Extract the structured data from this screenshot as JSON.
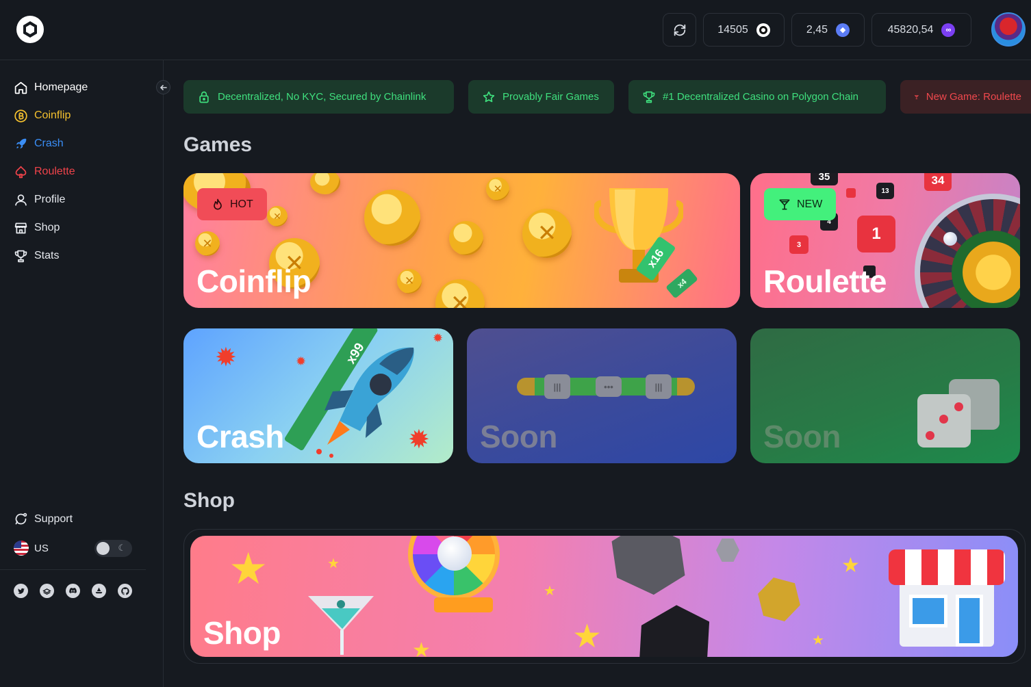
{
  "header": {
    "balances": [
      {
        "value": "14505",
        "icon": "token-icon",
        "color": "#ffffff"
      },
      {
        "value": "2,45",
        "icon": "eth-icon",
        "color": "#5b7cf5"
      },
      {
        "value": "45820,54",
        "icon": "polygon-icon",
        "color": "#7b3ff2"
      }
    ]
  },
  "sidebar": {
    "items": [
      {
        "label": "Homepage",
        "color": "#ffffff"
      },
      {
        "label": "Coinflip",
        "color": "#f5c12e"
      },
      {
        "label": "Crash",
        "color": "#3a8ef6"
      },
      {
        "label": "Roulette",
        "color": "#f0434a"
      },
      {
        "label": "Profile",
        "color": "#e6e9ee"
      },
      {
        "label": "Shop",
        "color": "#e6e9ee"
      },
      {
        "label": "Stats",
        "color": "#e6e9ee"
      }
    ],
    "support": "Support",
    "language": "US"
  },
  "banners": [
    {
      "label": "Decentralized, No KYC, Secured by Chainlink"
    },
    {
      "label": "Provably Fair Games"
    },
    {
      "label": "#1 Decentralized Casino on Polygon Chain"
    },
    {
      "label": "New Game: Roulette"
    }
  ],
  "sections": {
    "games": "Games",
    "shop": "Shop"
  },
  "games": {
    "coinflip": {
      "title": "Coinflip",
      "badge": "HOT",
      "multiplier_1": "x16",
      "multiplier_2": "x4"
    },
    "roulette": {
      "title": "Roulette",
      "badge": "NEW",
      "numbers": [
        "35",
        "34",
        "13",
        "1",
        "3",
        "4"
      ]
    },
    "crash": {
      "title": "Crash",
      "multiplier": "x99"
    },
    "soon_1": {
      "title": "Soon"
    },
    "soon_2": {
      "title": "Soon"
    }
  },
  "shop": {
    "title": "Shop"
  }
}
